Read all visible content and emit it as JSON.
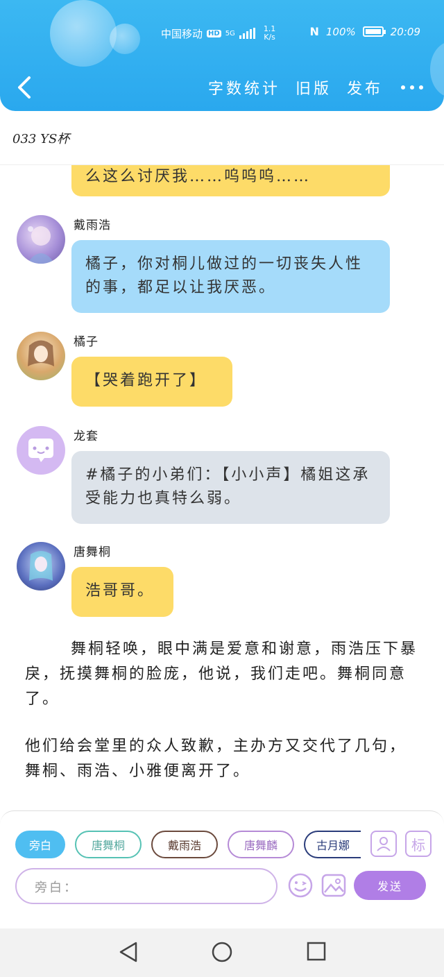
{
  "status_bar": {
    "carrier": "中国移动",
    "hd": "HD",
    "network": "5G",
    "speed_value": "1.1",
    "speed_unit": "K/s",
    "nfc": "N",
    "battery": "100%",
    "time": "20:09"
  },
  "toolbar": {
    "word_count": "字数统计",
    "old_version": "旧版",
    "publish": "发布"
  },
  "document": {
    "title": "033 YS杯"
  },
  "messages": [
    {
      "speaker": "",
      "text": "么这么讨厌我……呜呜呜……",
      "style": "yellow"
    },
    {
      "speaker": "戴雨浩",
      "text": "橘子，你对桐儿做过的一切丧失人性的事，都足以让我厌恶。",
      "style": "blue"
    },
    {
      "speaker": "橘子",
      "text": "【哭着跑开了】",
      "style": "yellow"
    },
    {
      "speaker": "龙套",
      "text": "#橘子的小弟们：【小小声】橘姐这承受能力也真特么弱。",
      "style": "gray"
    },
    {
      "speaker": "唐舞桐",
      "text": "浩哥哥。",
      "style": "yellow"
    }
  ],
  "narration": [
    "舞桐轻唤，眼中满是爱意和谢意，雨浩压下暴戾，抚摸舞桐的脸庞，他说，我们走吧。舞桐同意了。",
    "他们给会堂里的众人致歉，主办方又交代了几句，舞桐、雨浩、小雅便离开了。"
  ],
  "composer": {
    "roles": [
      "旁白",
      "唐舞桐",
      "戴雨浩",
      "唐舞麟",
      "古月娜"
    ],
    "tag_label": "标",
    "input_placeholder": "旁白：",
    "send_label": "发送"
  },
  "colors": {
    "header": "#2aa8ee",
    "yellow_bubble": "#fddb68",
    "blue_bubble": "#a5dbfa",
    "gray_bubble": "#dde3ea",
    "send_button": "#b07ee6"
  }
}
